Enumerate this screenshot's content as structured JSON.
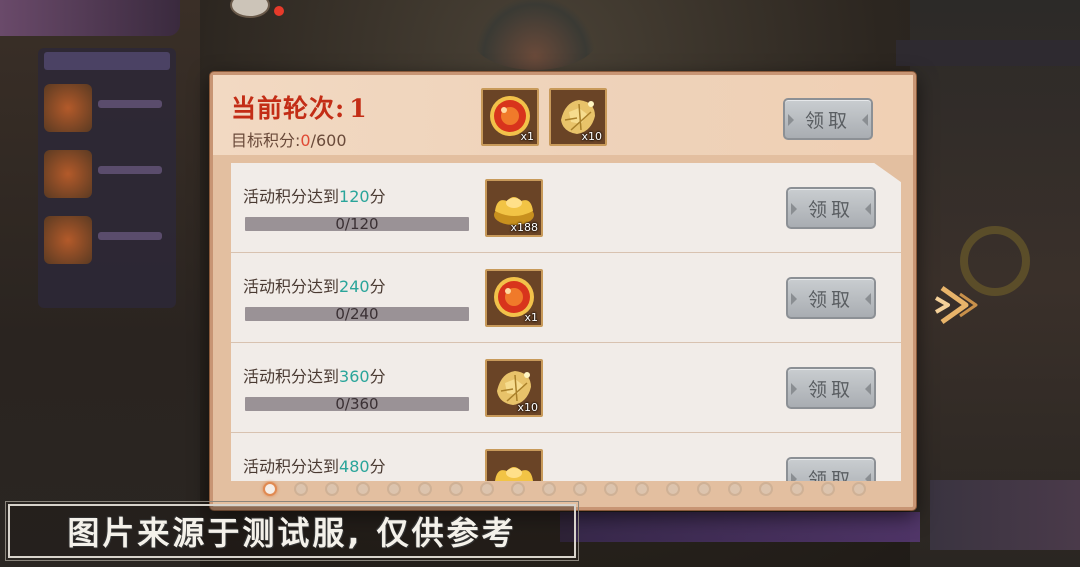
{
  "header": {
    "round_label": "当前轮次:",
    "round_number": "1",
    "target_label": "目标积分:",
    "target_current": "0",
    "target_total": "/600",
    "rewards": [
      {
        "icon": "red-orb-icon",
        "count": "x1"
      },
      {
        "icon": "gold-fragment-icon",
        "count": "x10"
      }
    ],
    "claim_label": "领取"
  },
  "tasks": [
    {
      "text_prefix": "活动积分达到",
      "points": "120",
      "text_suffix": "分",
      "progress": "0/120",
      "progress_fraction": 0,
      "reward": {
        "icon": "gold-ingot-icon",
        "count": "x188"
      },
      "claim_label": "领取"
    },
    {
      "text_prefix": "活动积分达到",
      "points": "240",
      "text_suffix": "分",
      "progress": "0/240",
      "progress_fraction": 0,
      "reward": {
        "icon": "red-orb-icon",
        "count": "x1"
      },
      "claim_label": "领取"
    },
    {
      "text_prefix": "活动积分达到",
      "points": "360",
      "text_suffix": "分",
      "progress": "0/360",
      "progress_fraction": 0,
      "reward": {
        "icon": "gold-fragment-icon",
        "count": "x10"
      },
      "claim_label": "领取"
    },
    {
      "text_prefix": "活动积分达到",
      "points": "480",
      "text_suffix": "分",
      "progress": "",
      "progress_fraction": 0,
      "reward": {
        "icon": "gold-ingot-icon",
        "count": ""
      },
      "claim_label": "领取"
    }
  ],
  "pager": {
    "total": 20,
    "active": 0
  },
  "watermark": "图片来源于测试服, 仅供参考",
  "colors": {
    "title_red": "#c32d16",
    "points_teal": "#2aa59a",
    "button_gray": "#b8bcc0"
  }
}
